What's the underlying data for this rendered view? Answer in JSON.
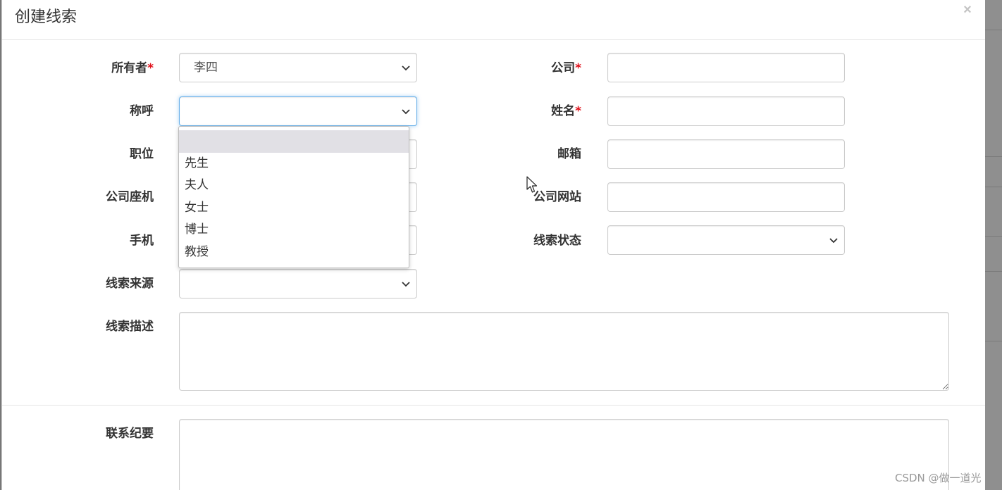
{
  "modal": {
    "title": "创建线索",
    "close_label": "×"
  },
  "form": {
    "required_mark": "*",
    "owner": {
      "label": "所有者",
      "value": "李四"
    },
    "company": {
      "label": "公司",
      "value": ""
    },
    "salutation": {
      "label": "称呼",
      "value": "",
      "options": [
        "",
        "先生",
        "夫人",
        "女士",
        "博士",
        "教授"
      ]
    },
    "name": {
      "label": "姓名",
      "value": ""
    },
    "job_title": {
      "label": "职位",
      "value": ""
    },
    "email": {
      "label": "邮箱",
      "value": ""
    },
    "company_phone": {
      "label": "公司座机",
      "value": ""
    },
    "company_website": {
      "label": "公司网站",
      "value": ""
    },
    "mobile": {
      "label": "手机",
      "value": ""
    },
    "lead_status": {
      "label": "线索状态",
      "value": ""
    },
    "lead_source": {
      "label": "线索来源",
      "value": ""
    },
    "lead_description": {
      "label": "线索描述",
      "value": ""
    },
    "contact_summary": {
      "label": "联系纪要",
      "value": ""
    }
  },
  "watermark": "CSDN @做一道光",
  "icons": {
    "close": "close-icon",
    "chevron": "chevron-down-icon",
    "cursor": "mouse-cursor-icon"
  },
  "colors": {
    "required": "#e0101a",
    "focus_border": "#66afe9",
    "option_highlight": "#e1e0e5"
  }
}
